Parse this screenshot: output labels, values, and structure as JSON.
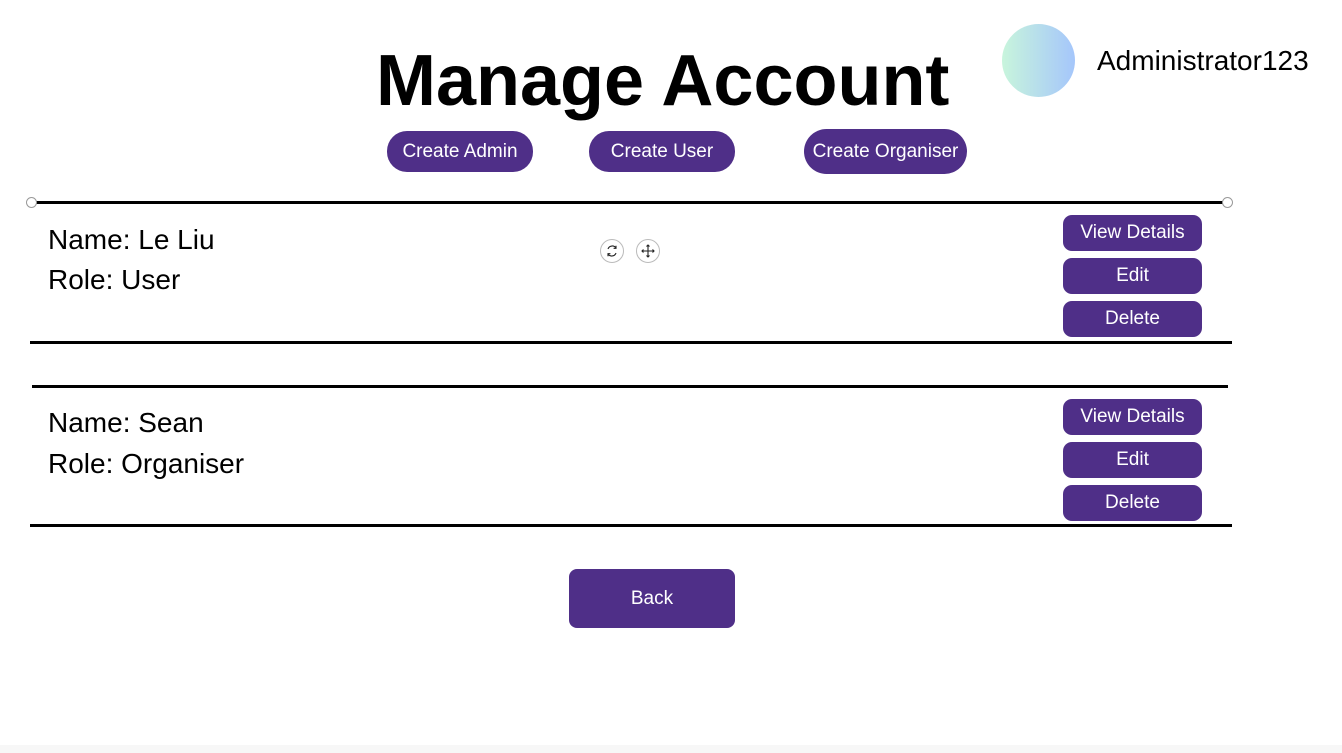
{
  "header": {
    "title": "Manage Account",
    "username": "Administrator123"
  },
  "create_buttons": {
    "admin": "Create Admin",
    "user": "Create User",
    "organiser": "Create Organiser"
  },
  "accounts": [
    {
      "name_line": "Name: Le Liu",
      "role_line": "Role: User",
      "actions": {
        "view": "View Details",
        "edit": "Edit",
        "delete": "Delete"
      }
    },
    {
      "name_line": "Name: Sean",
      "role_line": "Role: Organiser",
      "actions": {
        "view": "View Details",
        "edit": "Edit",
        "delete": "Delete"
      }
    }
  ],
  "editor_tools": {
    "rotate_icon": "rotate-icon",
    "move_icon": "move-icon"
  },
  "footer": {
    "back_label": "Back"
  },
  "colors": {
    "accent": "#4f2f88",
    "avatar_gradient_start": "#c8f5dc",
    "avatar_gradient_end": "#a5c6fb"
  }
}
